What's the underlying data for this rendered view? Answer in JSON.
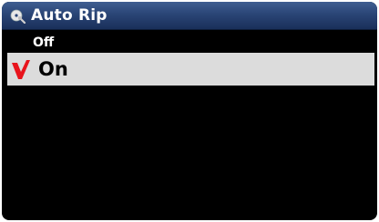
{
  "header": {
    "title": "Auto Rip",
    "icon": "disc-settings-icon"
  },
  "menu": {
    "items": [
      {
        "label": "Off",
        "selected": false,
        "checked": false
      },
      {
        "label": "On",
        "selected": true,
        "checked": true
      }
    ]
  },
  "colors": {
    "title_bar": "#2a4576",
    "background": "#000000",
    "selection": "#dcdcdc",
    "check_mark": "#e8141c"
  }
}
